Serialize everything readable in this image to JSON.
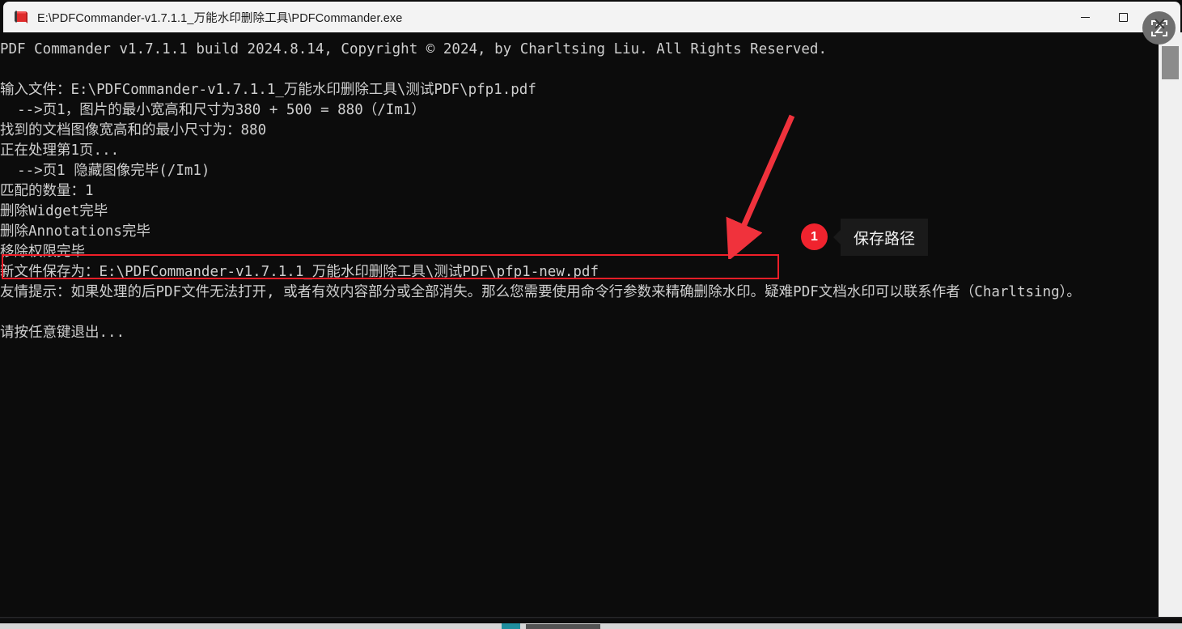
{
  "window": {
    "title": "E:\\PDFCommander-v1.7.1.1_万能水印删除工具\\PDFCommander.exe",
    "icon": "pdf-book-icon",
    "controls": {
      "minimize_label": "最小化",
      "maximize_label": "最大化",
      "close_label": "关闭"
    },
    "capture_overlay_icon": "screen-capture-icon"
  },
  "console": {
    "lines": [
      "PDF Commander v1.7.1.1 build 2024.8.14, Copyright © 2024, by Charltsing Liu. All Rights Reserved.",
      "",
      "输入文件：E:\\PDFCommander-v1.7.1.1_万能水印删除工具\\测试PDF\\pfp1.pdf",
      "  -->页1，图片的最小宽高和尺寸为380 + 500 = 880（/Im1）",
      "找到的文档图像宽高和的最小尺寸为：880",
      "正在处理第1页...",
      "  -->页1 隐藏图像完毕(/Im1)",
      "匹配的数量：1",
      "删除Widget完毕",
      "删除Annotations完毕",
      "移除权限完毕"
    ],
    "highlighted_line": "新文件保存为：E:\\PDFCommander-v1.7.1.1_万能水印删除工具\\测试PDF\\pfp1-new.pdf",
    "tip": "友情提示：如果处理的后PDF文件无法打开, 或者有效内容部分或全部消失。那么您需要使用命令行参数来精确删除水印。疑难PDF文档水印可以联系作者（Charltsing）。",
    "prompt": "请按任意键退出..."
  },
  "annotation": {
    "badge_number": "1",
    "tooltip_label": "保存路径",
    "box_color": "#f01e28",
    "arrow_color": "#f0323c",
    "badge_color": "#f0232e",
    "tooltip_bg": "#1a1a1a"
  },
  "scrollbar": {
    "orientation": "vertical",
    "thumb_position": "near-top"
  }
}
